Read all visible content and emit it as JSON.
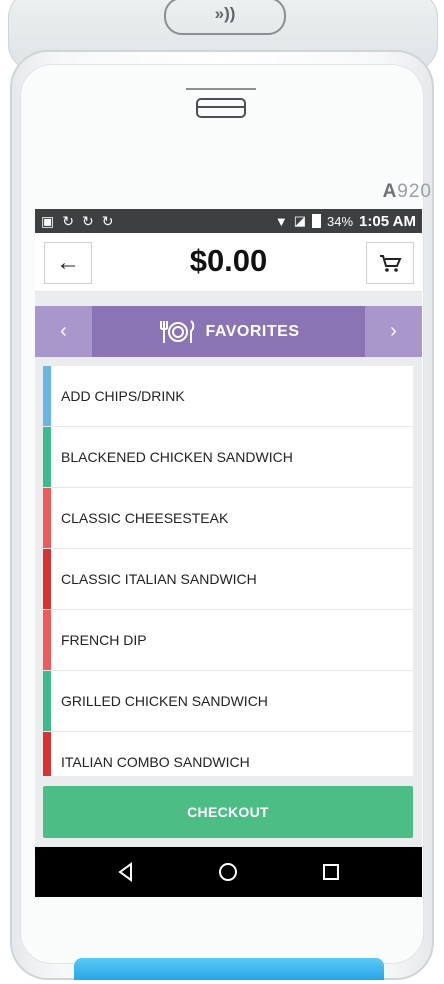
{
  "device": {
    "nfc_label": "»))",
    "model_prefix": "A",
    "model_number": "920"
  },
  "status_bar": {
    "battery_percent": "34%",
    "time": "1:05 AM",
    "icons": [
      "image-icon",
      "sync-icon",
      "sync-icon",
      "sync-icon",
      "wifi-icon",
      "no-sim-icon",
      "battery-icon"
    ]
  },
  "header": {
    "back_icon": "←",
    "total": "$0.00",
    "cart_icon": "cart-icon"
  },
  "category": {
    "prev": "‹",
    "next": "›",
    "name": "FAVORITES",
    "icon": "utensils-plate-icon"
  },
  "items": [
    {
      "label": "ADD CHIPS/DRINK",
      "color": "#6cb5e2"
    },
    {
      "label": "BLACKENED CHICKEN SANDWICH",
      "color": "#3dba8e"
    },
    {
      "label": "CLASSIC CHEESESTEAK",
      "color": "#ef5a5a"
    },
    {
      "label": "CLASSIC ITALIAN SANDWICH",
      "color": "#d93232"
    },
    {
      "label": "FRENCH DIP",
      "color": "#ef5a5a"
    },
    {
      "label": "GRILLED CHICKEN SANDWICH",
      "color": "#3dba8e"
    },
    {
      "label": "ITALIAN COMBO SANDWICH",
      "color": "#d93232"
    }
  ],
  "checkout": {
    "label": "CHECKOUT",
    "color": "#4cbe85"
  },
  "colors": {
    "accent": "#8b74b3",
    "accent_light": "#a997cb",
    "status_bar": "#3d3f41"
  }
}
